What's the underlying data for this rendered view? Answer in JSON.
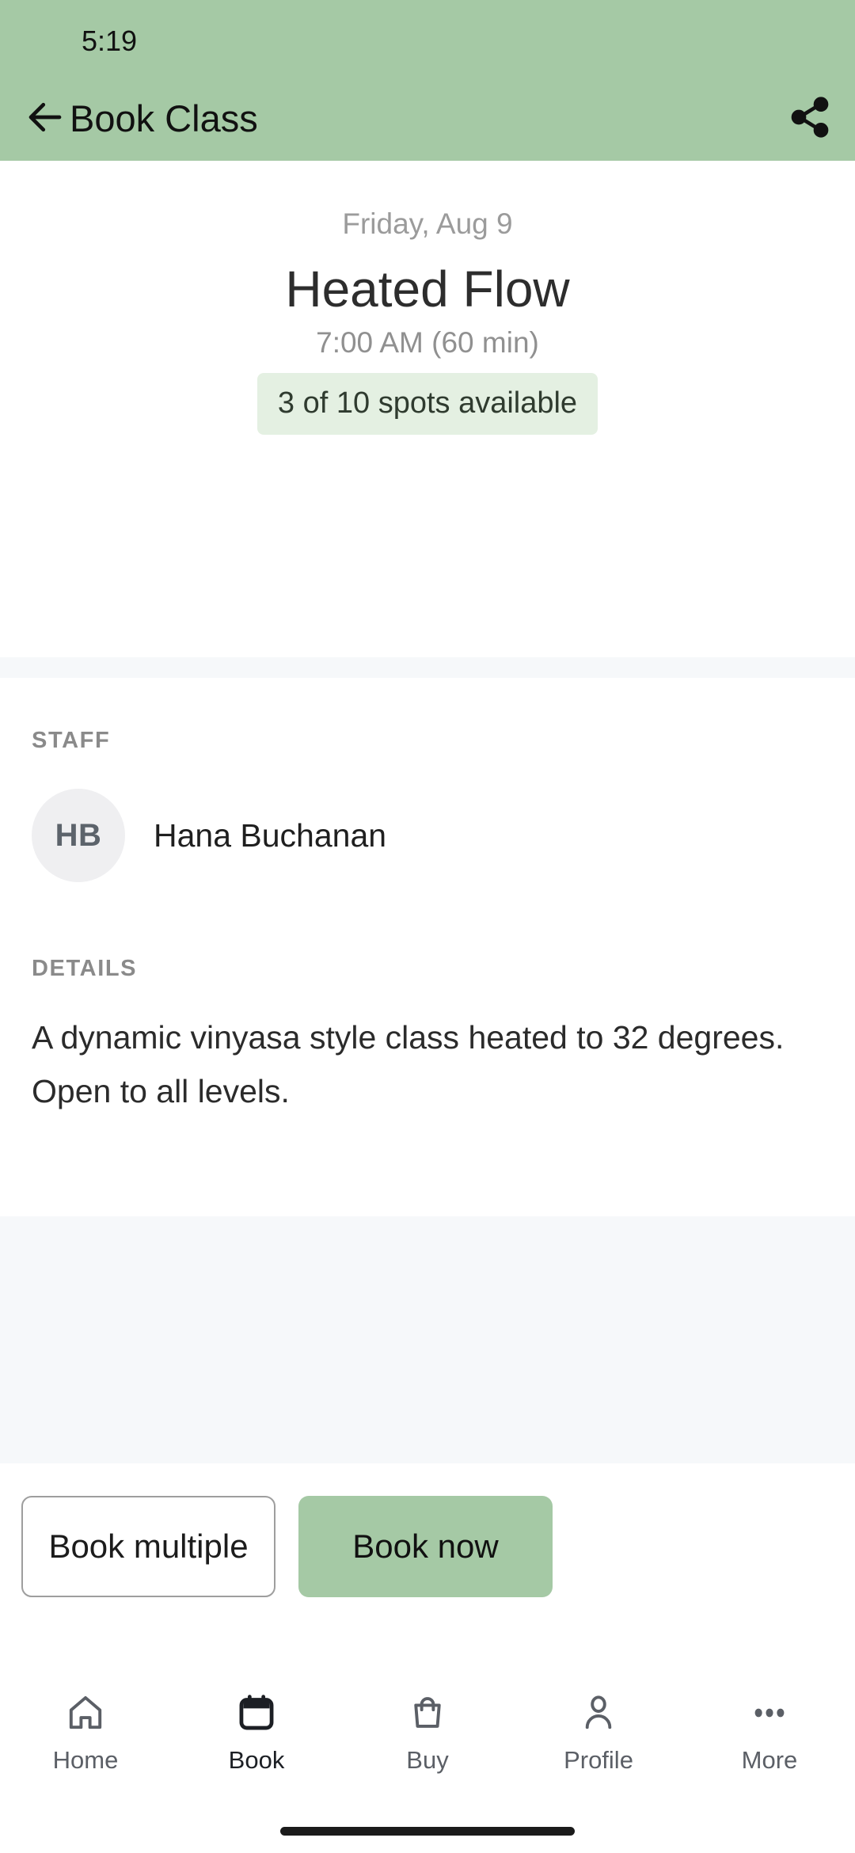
{
  "status_bar": {
    "time": "5:19"
  },
  "app_bar": {
    "title": "Book Class",
    "back_icon": "arrow-left-icon",
    "share_icon": "share-icon"
  },
  "class": {
    "date": "Friday, Aug 9",
    "name": "Heated Flow",
    "time": "7:00 AM (60 min)",
    "availability": "3 of 10 spots available"
  },
  "staff_section": {
    "label": "STAFF",
    "members": [
      {
        "initials": "HB",
        "name": "Hana Buchanan"
      }
    ]
  },
  "details_section": {
    "label": "DETAILS",
    "body": "A dynamic vinyasa style class heated to 32 degrees. Open to all levels."
  },
  "actions": {
    "book_multiple_label": "Book multiple",
    "book_now_label": "Book now"
  },
  "tab_bar": {
    "tabs": [
      {
        "label": "Home",
        "icon": "home-icon",
        "active": false
      },
      {
        "label": "Book",
        "icon": "calendar-icon",
        "active": true
      },
      {
        "label": "Buy",
        "icon": "shopping-bag-icon",
        "active": false
      },
      {
        "label": "Profile",
        "icon": "person-icon",
        "active": false
      },
      {
        "label": "More",
        "icon": "more-dots-icon",
        "active": false
      }
    ]
  },
  "colors": {
    "brand_green": "#a5c9a5",
    "badge_green": "#e4f0e2",
    "section_gray": "#f6f8fa",
    "muted_text": "#909090"
  }
}
